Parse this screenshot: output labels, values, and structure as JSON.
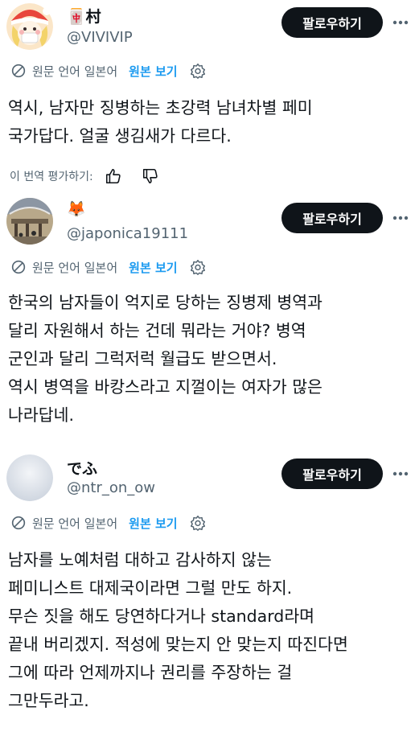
{
  "follow_label": "팔로우하기",
  "translate": {
    "language_note": "원문 언어 일본어",
    "show_original": "원본 보기"
  },
  "posts": [
    {
      "display_name": "🀄村",
      "handle": "@VIVIVIP",
      "body_lines": [
        "역시, 남자만 징병하는 초강력 남녀차별 페미",
        "국가답다. 얼굴 생김새가 다르다."
      ],
      "rate_label": "이 번역 평가하기:"
    },
    {
      "display_name": "🦊",
      "handle": "@japonica19111",
      "body_lines": [
        "한국의 남자들이 억지로 당하는 징병제 병역과",
        "달리 자원해서 하는 건데 뭐라는 거야? 병역",
        "군인과 달리 그럭저럭 월급도 받으면서.",
        "역시 병역을 바캉스라고 지껄이는 여자가 많은",
        "나라답네."
      ]
    },
    {
      "display_name": "でふ",
      "handle": "@ntr_on_ow",
      "body_lines": [
        "남자를 노예처럼 대하고 감사하지 않는",
        "페미니스트 대제국이라면 그럴 만도 하지.",
        "무슨 짓을 해도 당연하다거나 standard라며",
        "끝내 버리겠지. 적성에 맞는지 안 맞는지 따진다면",
        "그에 따라 언제까지나 권리를 주장하는 걸",
        "그만두라고."
      ]
    }
  ],
  "colors": {
    "text": "#0f1419",
    "secondary": "#536471",
    "link": "#1d9bf0",
    "button_bg": "#0f1419",
    "button_text": "#ffffff"
  }
}
